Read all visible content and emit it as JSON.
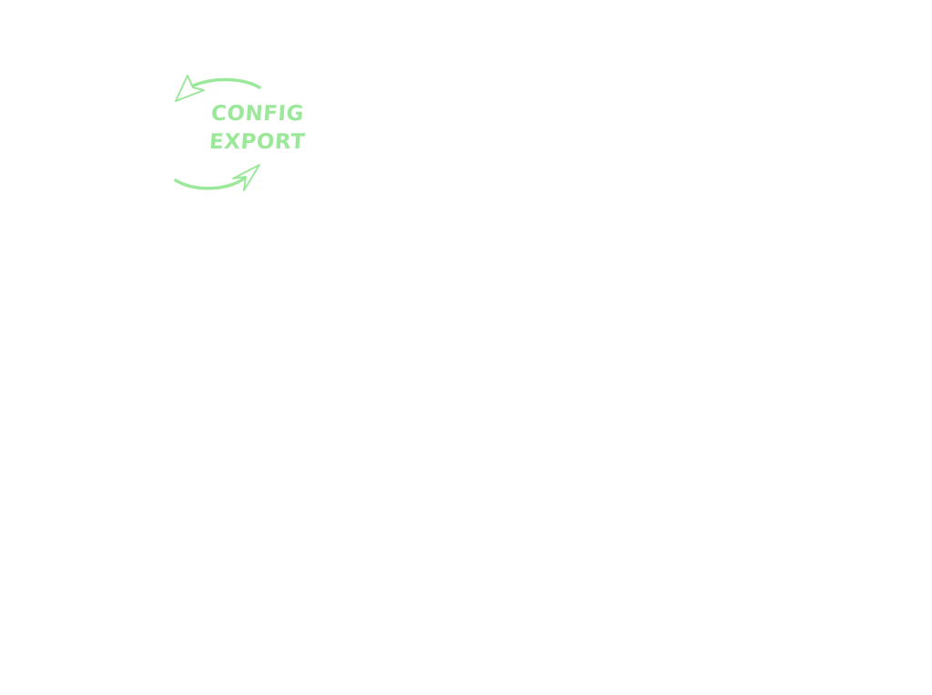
{
  "logo": {
    "line1": "CONFIG",
    "line2": "EXPORT",
    "color": "#9be89b",
    "icon": "sync-arrows-icon"
  }
}
